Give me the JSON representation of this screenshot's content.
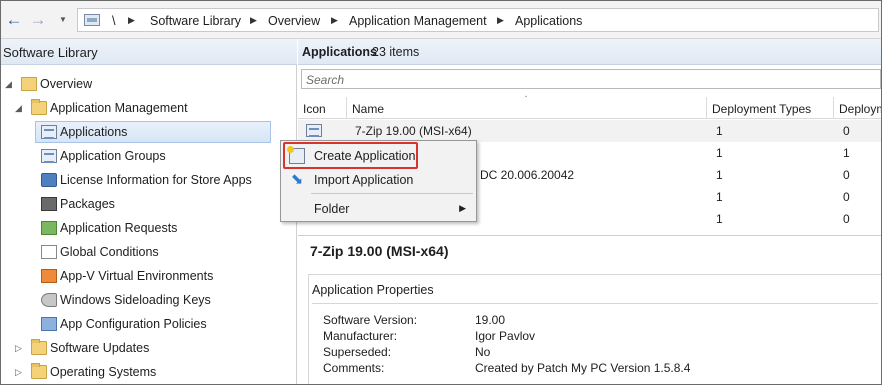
{
  "nav": {
    "back_icon": "back-arrow-icon",
    "forward_icon": "forward-arrow-icon",
    "history_icon": "history-dropdown-icon"
  },
  "breadcrumb": {
    "root": "\\",
    "items": [
      "Software Library",
      "Overview",
      "Application Management",
      "Applications"
    ]
  },
  "sidebar": {
    "title": "Software Library",
    "items": [
      {
        "label": "Overview",
        "icon": "folder-icon"
      },
      {
        "label": "Application Management",
        "icon": "folder-icon"
      },
      {
        "label": "Applications",
        "icon": "application-icon",
        "selected": true
      },
      {
        "label": "Application Groups",
        "icon": "application-group-icon"
      },
      {
        "label": "License Information for Store Apps",
        "icon": "license-icon"
      },
      {
        "label": "Packages",
        "icon": "package-icon"
      },
      {
        "label": "Application Requests",
        "icon": "request-icon"
      },
      {
        "label": "Global Conditions",
        "icon": "global-conditions-icon"
      },
      {
        "label": "App-V Virtual Environments",
        "icon": "appv-icon"
      },
      {
        "label": "Windows Sideloading Keys",
        "icon": "key-icon"
      },
      {
        "label": "App Configuration Policies",
        "icon": "config-policy-icon"
      },
      {
        "label": "Software Updates",
        "icon": "folder-icon"
      },
      {
        "label": "Operating Systems",
        "icon": "folder-icon"
      }
    ]
  },
  "main": {
    "title": "Applications",
    "count": "23 items",
    "search_placeholder": "Search",
    "columns": [
      "Icon",
      "Name",
      "Deployment Types",
      "Deploym"
    ],
    "rows": [
      {
        "name": "7-Zip 19.00 (MSI-x64)",
        "deployment_types": "1",
        "deployments": "0"
      },
      {
        "name": "",
        "deployment_types": "1",
        "deployments": "1"
      },
      {
        "name": "DC 20.006.20042",
        "deployment_types": "1",
        "deployments": "0"
      },
      {
        "name": "",
        "deployment_types": "1",
        "deployments": "0"
      },
      {
        "name": "",
        "deployment_types": "1",
        "deployments": "0"
      }
    ]
  },
  "details": {
    "title": "7-Zip 19.00 (MSI-x64)",
    "section": "Application Properties",
    "props": [
      {
        "label": "Software Version:",
        "value": "19.00"
      },
      {
        "label": "Manufacturer:",
        "value": "Igor Pavlov"
      },
      {
        "label": "Superseded:",
        "value": "No"
      },
      {
        "label": "Comments:",
        "value": "Created by Patch My PC Version 1.5.8.4"
      }
    ]
  },
  "context_menu": {
    "items": [
      {
        "label": "Create Application",
        "icon": "create-application-icon",
        "highlighted": true
      },
      {
        "label": "Import Application",
        "icon": "import-icon"
      },
      {
        "label": "Folder",
        "icon": "",
        "has_submenu": true
      }
    ]
  },
  "colors": {
    "highlight": "#d9332d",
    "selection": "#d6e5f6",
    "header": "#dfe8f4"
  }
}
